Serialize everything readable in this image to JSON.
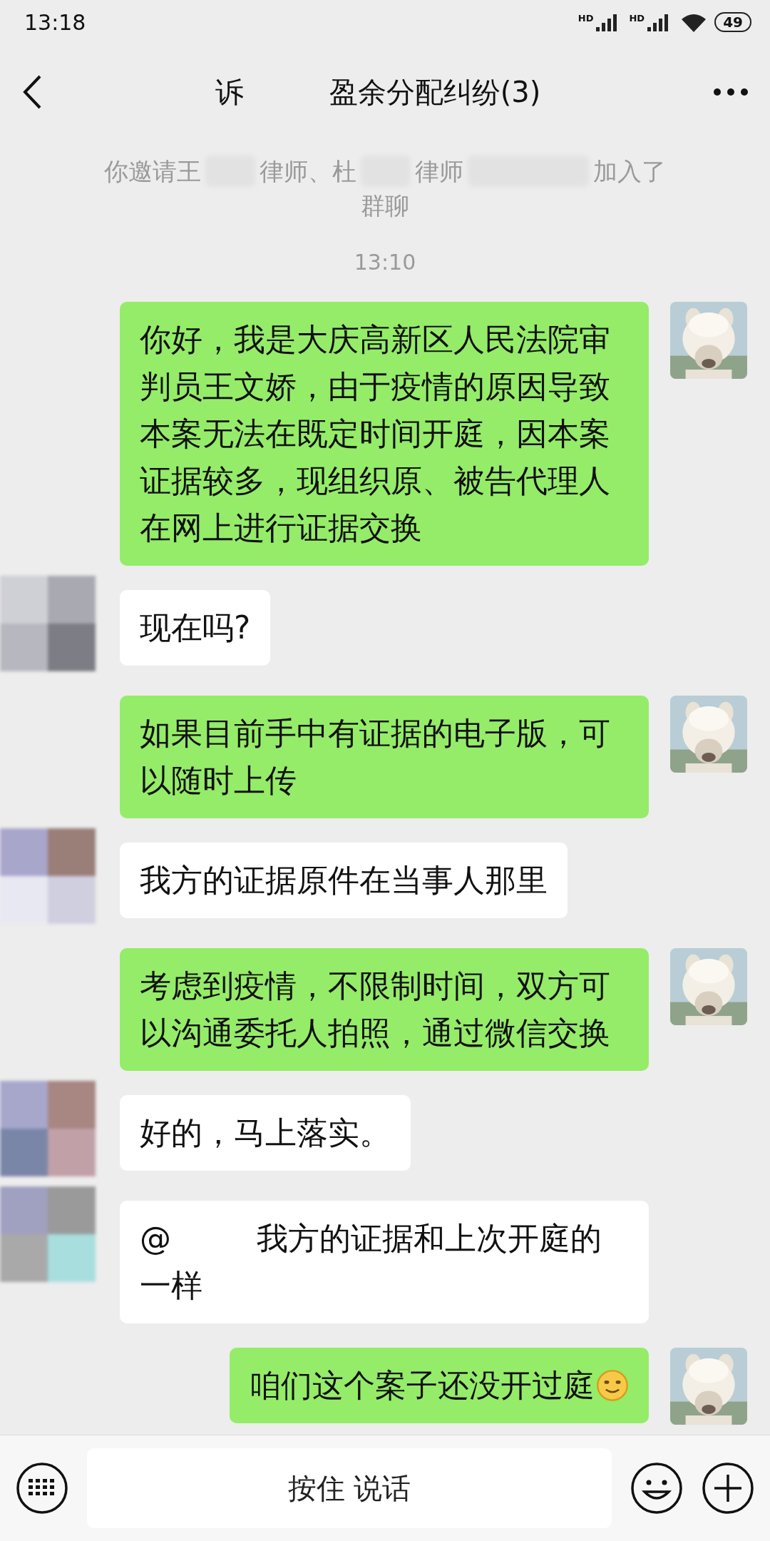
{
  "status_bar": {
    "time": "13:18",
    "signal_labels": [
      "HD",
      "HD"
    ],
    "battery": "49"
  },
  "header": {
    "title_segments": [
      "诉",
      "盈余分配纠纷(3)"
    ]
  },
  "messages": [
    {
      "kind": "system",
      "segments": [
        "你邀请王",
        "律师、杜",
        "律师",
        "加入了"
      ],
      "tail": "群聊"
    },
    {
      "kind": "time",
      "text": "13:10"
    },
    {
      "kind": "out",
      "text": "你好，我是大庆高新区人民法院审判员王文娇，由于疫情的原因导致本案无法在既定时间开庭，因本案证据较多，现组织原、被告代理人在网上进行证据交换"
    },
    {
      "kind": "in",
      "segments": [
        "现在吗?"
      ]
    },
    {
      "kind": "out",
      "text": "如果目前手中有证据的电子版，可以随时上传"
    },
    {
      "kind": "in",
      "segments": [
        "我方的证据原件在当事人那里"
      ]
    },
    {
      "kind": "out",
      "text": "考虑到疫情，不限制时间，双方可以沟通委托人拍照，通过微信交换"
    },
    {
      "kind": "in",
      "segments": [
        "好的，马上落实。"
      ]
    },
    {
      "kind": "in",
      "segments": [
        "@",
        "我方的证据和上次开庭的一样"
      ]
    },
    {
      "kind": "out",
      "text": "咱们这个案子还没开过庭",
      "emoji": true
    }
  ],
  "input_bar": {
    "voice_button": "按住 说话"
  }
}
